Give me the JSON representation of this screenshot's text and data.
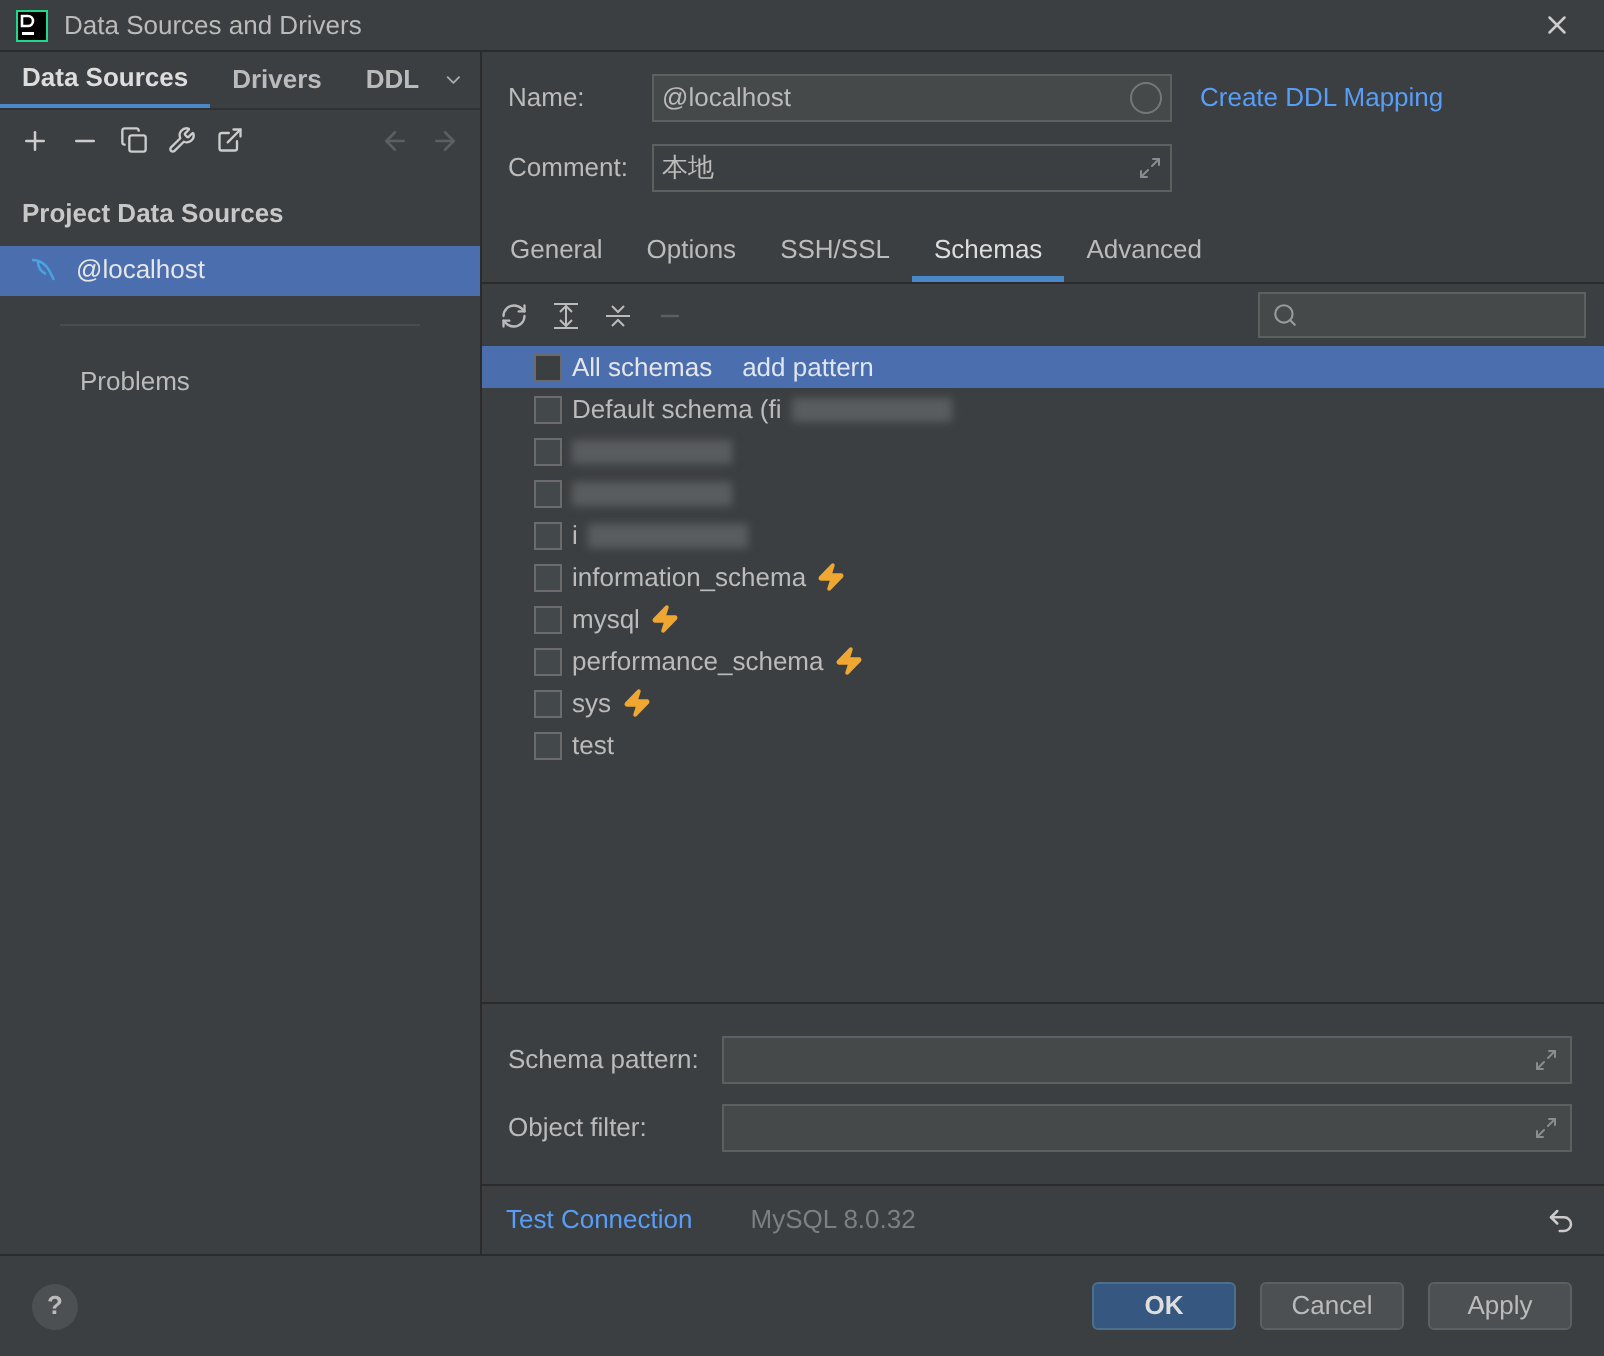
{
  "window": {
    "title": "Data Sources and Drivers"
  },
  "left_tabs": [
    {
      "label": "Data Sources",
      "selected": true
    },
    {
      "label": "Drivers",
      "selected": false
    },
    {
      "label": "DDL",
      "selected": false
    }
  ],
  "sidebar": {
    "section_title": "Project Data Sources",
    "items": [
      {
        "label": "@localhost",
        "selected": true
      }
    ],
    "problems": "Problems"
  },
  "form": {
    "name_label": "Name:",
    "name_value": "@localhost",
    "ddl_link": "Create DDL Mapping",
    "comment_label": "Comment:",
    "comment_value": "本地"
  },
  "tabs": [
    {
      "label": "General",
      "selected": false
    },
    {
      "label": "Options",
      "selected": false
    },
    {
      "label": "SSH/SSL",
      "selected": false
    },
    {
      "label": "Schemas",
      "selected": true
    },
    {
      "label": "Advanced",
      "selected": false
    }
  ],
  "schemas": [
    {
      "kind": "all",
      "label": "All schemas",
      "action": "add pattern",
      "checked": false,
      "selected": true
    },
    {
      "kind": "redacted",
      "label": "Default schema (fi",
      "checked": false,
      "selected": false
    },
    {
      "kind": "redacted",
      "checked": false,
      "selected": false
    },
    {
      "kind": "redacted",
      "checked": false,
      "selected": false
    },
    {
      "kind": "redacted",
      "label": "i",
      "checked": false,
      "selected": false
    },
    {
      "kind": "schema",
      "label": "information_schema",
      "bolt": true,
      "checked": false,
      "selected": false
    },
    {
      "kind": "schema",
      "label": "mysql",
      "bolt": true,
      "checked": false,
      "selected": false
    },
    {
      "kind": "schema",
      "label": "performance_schema",
      "bolt": true,
      "checked": false,
      "selected": false
    },
    {
      "kind": "schema",
      "label": "sys",
      "bolt": true,
      "checked": false,
      "selected": false
    },
    {
      "kind": "schema",
      "label": "test",
      "bolt": false,
      "checked": false,
      "selected": false
    }
  ],
  "filters": [
    {
      "label": "Schema pattern:"
    },
    {
      "label": "Object filter:"
    }
  ],
  "footer": {
    "test_connection": "Test Connection",
    "driver_version": "MySQL 8.0.32"
  },
  "buttons": [
    {
      "label": "OK",
      "primary": true
    },
    {
      "label": "Cancel",
      "primary": false
    },
    {
      "label": "Apply",
      "primary": false
    }
  ],
  "help": "?"
}
